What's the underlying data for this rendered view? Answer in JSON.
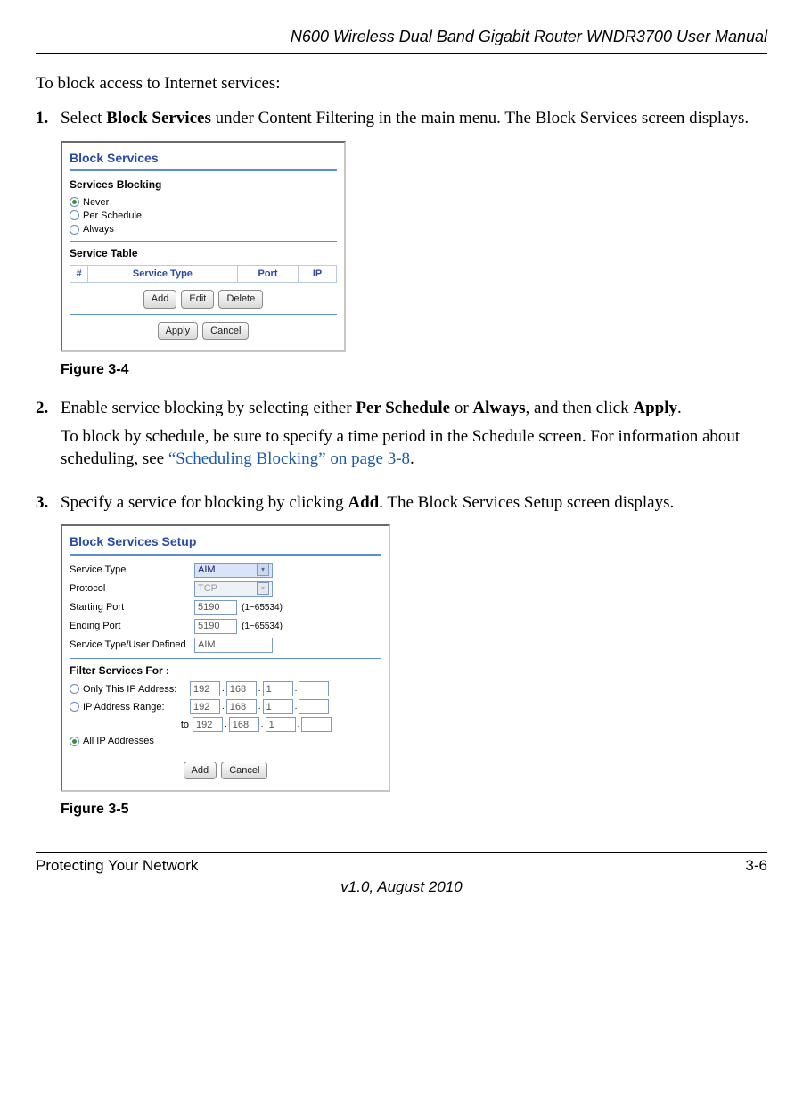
{
  "header": {
    "running": "N600 Wireless Dual Band Gigabit Router WNDR3700 User Manual"
  },
  "intro": "To block access to Internet services:",
  "step1": {
    "num": "1.",
    "pre": "Select ",
    "bold": "Block Services",
    "post": " under Content Filtering in the main menu. The Block Services screen displays."
  },
  "fig34": {
    "title": "Block Services",
    "sb_label": "Services Blocking",
    "opt_never": "Never",
    "opt_per": "Per Schedule",
    "opt_always": "Always",
    "st_label": "Service Table",
    "th_num": "#",
    "th_type": "Service Type",
    "th_port": "Port",
    "th_ip": "IP",
    "btn_add": "Add",
    "btn_edit": "Edit",
    "btn_delete": "Delete",
    "btn_apply": "Apply",
    "btn_cancel": "Cancel",
    "caption": "Figure 3-4"
  },
  "step2": {
    "num": "2.",
    "t1": "Enable service blocking by selecting either ",
    "b1": "Per Schedule",
    "t2": " or ",
    "b2": "Always",
    "t3": ", and then click ",
    "b3": "Apply",
    "t4": ".",
    "note_pre": "To block by schedule, be sure to specify a time period in the Schedule screen. For information about scheduling, see ",
    "note_link": "“Scheduling Blocking” on page 3-8",
    "note_post": "."
  },
  "step3": {
    "num": "3.",
    "t1": "Specify a service for blocking by clicking ",
    "b1": "Add",
    "t2": ". The Block Services Setup screen displays."
  },
  "fig35": {
    "title": "Block Services Setup",
    "lbl_service_type": "Service Type",
    "val_service_type": "AIM",
    "lbl_protocol": "Protocol",
    "val_protocol": "TCP",
    "lbl_start": "Starting Port",
    "val_start": "5190",
    "hint_start": "(1~65534)",
    "lbl_end": "Ending Port",
    "val_end": "5190",
    "hint_end": "(1~65534)",
    "lbl_user": "Service Type/User Defined",
    "val_user": "AIM",
    "filter_label": "Filter Services For :",
    "opt_only": "Only This IP Address:",
    "opt_range": "IP Address Range:",
    "range_to": "to",
    "opt_all": "All IP Addresses",
    "ip_a": "192",
    "ip_b": "168",
    "ip_c": "1",
    "ip_d": "",
    "btn_add": "Add",
    "btn_cancel": "Cancel",
    "caption": "Figure 3-5"
  },
  "footer": {
    "left": "Protecting Your Network",
    "right": "3-6",
    "bottom": "v1.0, August 2010"
  }
}
